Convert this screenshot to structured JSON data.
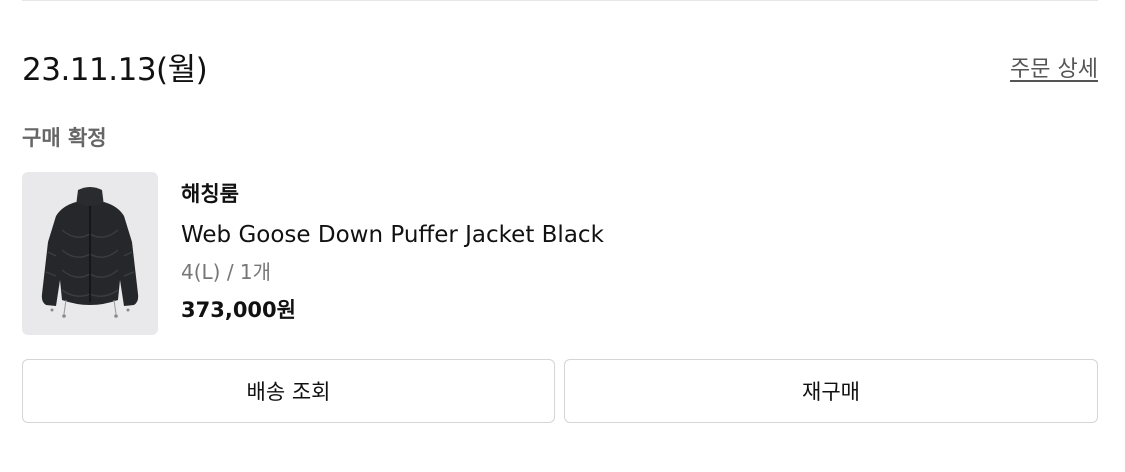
{
  "order": {
    "date": "23.11.13(월)",
    "detail_link": "주문 상세",
    "status": "구매 확정"
  },
  "product": {
    "image_icon": "black-puffer-jacket-image",
    "brand": "해칭룸",
    "name": "Web Goose Down Puffer Jacket Black",
    "option": "4(L) / 1개",
    "price": "373,000원"
  },
  "actions": {
    "tracking_label": "배송 조회",
    "reorder_label": "재구매"
  }
}
